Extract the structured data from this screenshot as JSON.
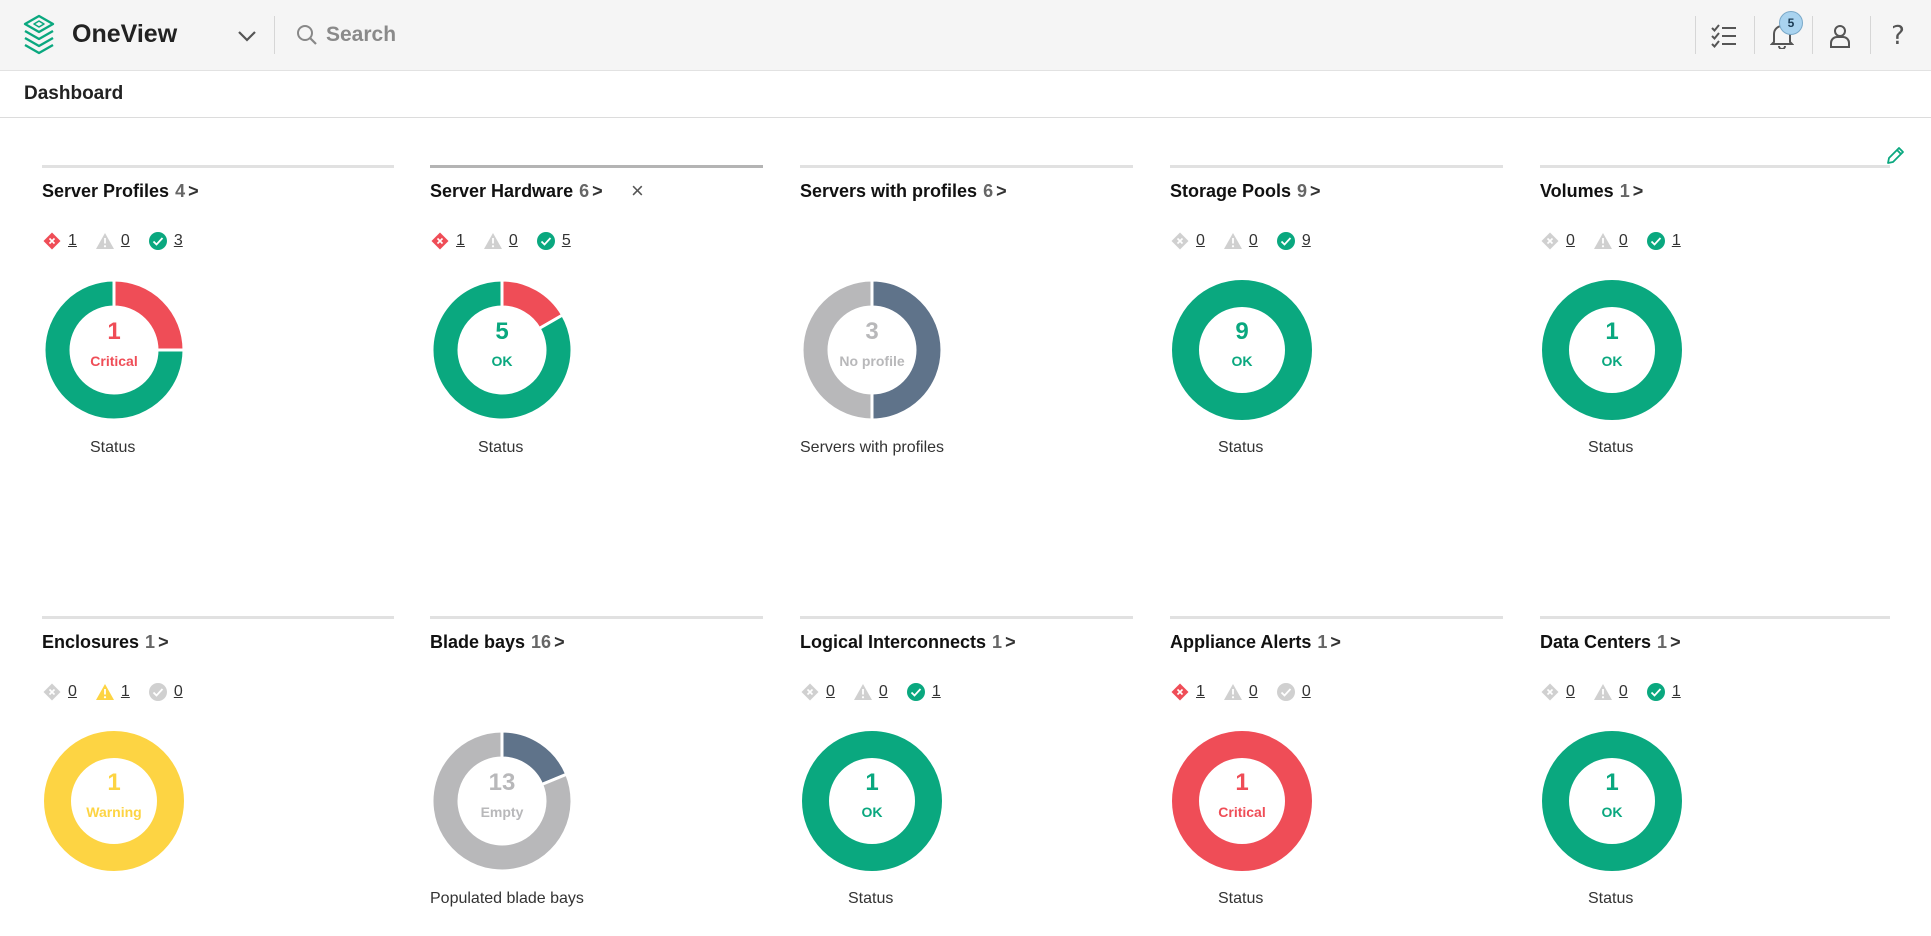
{
  "app": {
    "name": "OneView"
  },
  "search": {
    "placeholder": "Search"
  },
  "notifications": {
    "count": "5"
  },
  "page": {
    "title": "Dashboard"
  },
  "colors": {
    "critical": "#ef4d57",
    "ok": "#0aa87f",
    "warning": "#fdd443",
    "gray": "#b8b8ba",
    "slate": "#5f738a",
    "disabled": "#d0d0d0"
  },
  "cards": [
    {
      "title": "Server Profiles",
      "count": "4",
      "chev": ">",
      "critical": "1",
      "warning": "0",
      "ok": "3",
      "center_value": "1",
      "center_label": "Critical",
      "caption": "Status"
    },
    {
      "title": "Server Hardware",
      "count": "6",
      "chev": ">",
      "critical": "1",
      "warning": "0",
      "ok": "5",
      "center_value": "5",
      "center_label": "OK",
      "caption": "Status",
      "close": "×"
    },
    {
      "title": "Servers with profiles",
      "count": "6",
      "chev": ">",
      "center_value": "3",
      "center_label": "No profile",
      "caption": "Servers with profiles"
    },
    {
      "title": "Storage Pools",
      "count": "9",
      "chev": ">",
      "critical": "0",
      "warning": "0",
      "ok": "9",
      "center_value": "9",
      "center_label": "OK",
      "caption": "Status"
    },
    {
      "title": "Volumes",
      "count": "1",
      "chev": ">",
      "critical": "0",
      "warning": "0",
      "ok": "1",
      "center_value": "1",
      "center_label": "OK",
      "caption": "Status"
    },
    {
      "title": "Enclosures",
      "count": "1",
      "chev": ">",
      "critical": "0",
      "warning": "1",
      "ok": "0",
      "center_value": "1",
      "center_label": "Warning",
      "caption": ""
    },
    {
      "title": "Blade bays",
      "count": "16",
      "chev": ">",
      "center_value": "13",
      "center_label": "Empty",
      "caption": "Populated blade bays"
    },
    {
      "title": "Logical Interconnects",
      "count": "1",
      "chev": ">",
      "critical": "0",
      "warning": "0",
      "ok": "1",
      "center_value": "1",
      "center_label": "OK",
      "caption": "Status"
    },
    {
      "title": "Appliance Alerts",
      "count": "1",
      "chev": ">",
      "critical": "1",
      "warning": "0",
      "ok": "0",
      "center_value": "1",
      "center_label": "Critical",
      "caption": "Status"
    },
    {
      "title": "Data Centers",
      "count": "1",
      "chev": ">",
      "critical": "0",
      "warning": "0",
      "ok": "1",
      "center_value": "1",
      "center_label": "OK",
      "caption": "Status"
    }
  ],
  "chart_data": [
    {
      "type": "pie",
      "title": "Server Profiles",
      "categories": [
        "Critical",
        "OK"
      ],
      "values": [
        1,
        3
      ]
    },
    {
      "type": "pie",
      "title": "Server Hardware",
      "categories": [
        "Critical",
        "OK"
      ],
      "values": [
        1,
        5
      ]
    },
    {
      "type": "pie",
      "title": "Servers with profiles",
      "categories": [
        "With profile",
        "No profile"
      ],
      "values": [
        3,
        3
      ]
    },
    {
      "type": "pie",
      "title": "Storage Pools",
      "categories": [
        "OK"
      ],
      "values": [
        9
      ]
    },
    {
      "type": "pie",
      "title": "Volumes",
      "categories": [
        "OK"
      ],
      "values": [
        1
      ]
    },
    {
      "type": "pie",
      "title": "Enclosures",
      "categories": [
        "Warning"
      ],
      "values": [
        1
      ]
    },
    {
      "type": "pie",
      "title": "Blade bays",
      "categories": [
        "Populated",
        "Empty"
      ],
      "values": [
        3,
        13
      ]
    },
    {
      "type": "pie",
      "title": "Logical Interconnects",
      "categories": [
        "OK"
      ],
      "values": [
        1
      ]
    },
    {
      "type": "pie",
      "title": "Appliance Alerts",
      "categories": [
        "Critical"
      ],
      "values": [
        1
      ]
    },
    {
      "type": "pie",
      "title": "Data Centers",
      "categories": [
        "OK"
      ],
      "values": [
        1
      ]
    }
  ]
}
